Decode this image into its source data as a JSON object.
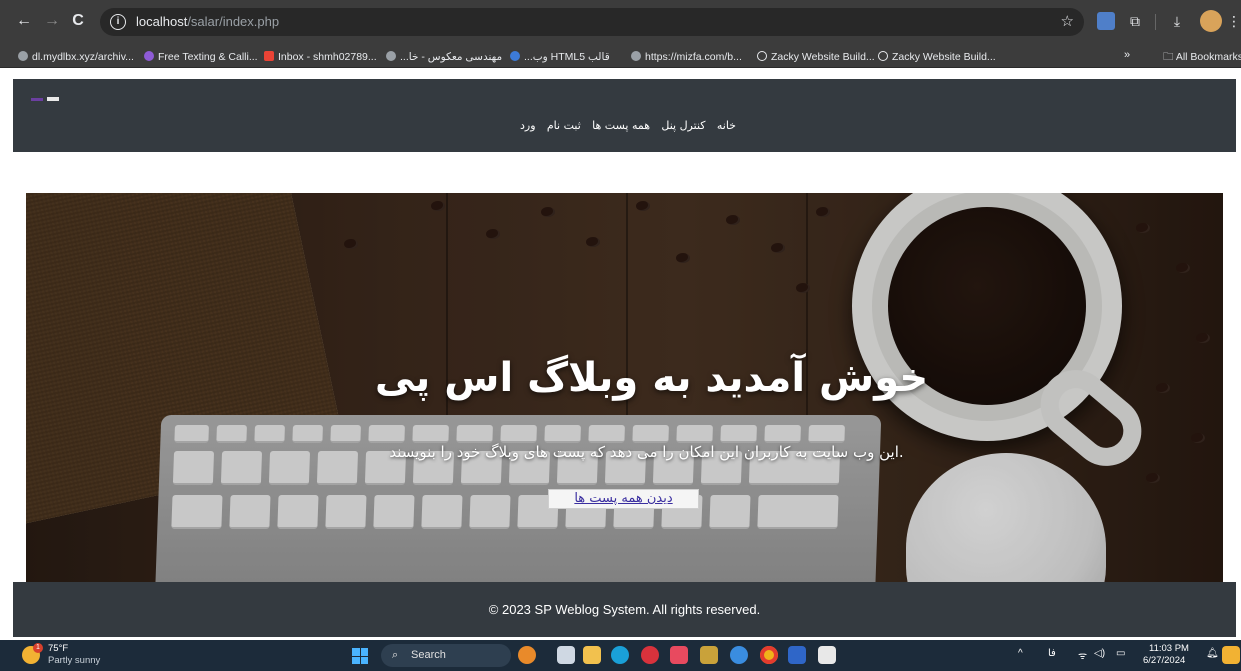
{
  "browser": {
    "url_host": "localhost",
    "url_path": "/salar/index.php",
    "back_glyph": "←",
    "forward_glyph": "→",
    "reload_glyph": "C",
    "star_glyph": "☆",
    "extension_label": "",
    "puzzle_glyph": "⧉",
    "download_glyph": "⤓",
    "menu_glyph": "⋮"
  },
  "bookmarks": {
    "items": [
      {
        "label": "dl.mydlbx.xyz/archiv...",
        "color": "#9aa0a6"
      },
      {
        "label": "Free Texting & Calli...",
        "color": "#8e5bd6"
      },
      {
        "label": "Inbox - shmh02789...",
        "color": "#ea4335"
      },
      {
        "label": "مهندسی معکوس - خا...",
        "color": "#9aa0a6"
      },
      {
        "label": "قالب HTML5 وب...",
        "color": "#3d7bd8"
      },
      {
        "label": "https://mizfa.com/b...",
        "color": "#9aa0a6"
      },
      {
        "label": "Zacky Website Build...",
        "color": "#9aa0a6"
      },
      {
        "label": "Zacky Website Build...",
        "color": "#9aa0a6"
      }
    ],
    "more": "»",
    "all_bookmarks": "All Bookmarks"
  },
  "site": {
    "nav": [
      "خانه",
      "کنترل پنل",
      "همه پست ها",
      "ثبت نام",
      "ورد"
    ],
    "hero_title": "خوش آمدید به وبلاگ اس پی",
    "hero_subtitle": ".این وب سایت به کاربران این امکان را می دهد که پست های وبلاگ خود را بنویسند",
    "hero_button": "دیدن همه پست ها",
    "footer": "© 2023 SP Weblog System. All rights reserved."
  },
  "taskbar": {
    "weather_temp": "75°F",
    "weather_desc": "Partly sunny",
    "weather_badge": "1",
    "search_label": "Search",
    "search_glyph": "⌕",
    "lang": "فا",
    "time": "11:03 PM",
    "date": "6/27/2024"
  }
}
